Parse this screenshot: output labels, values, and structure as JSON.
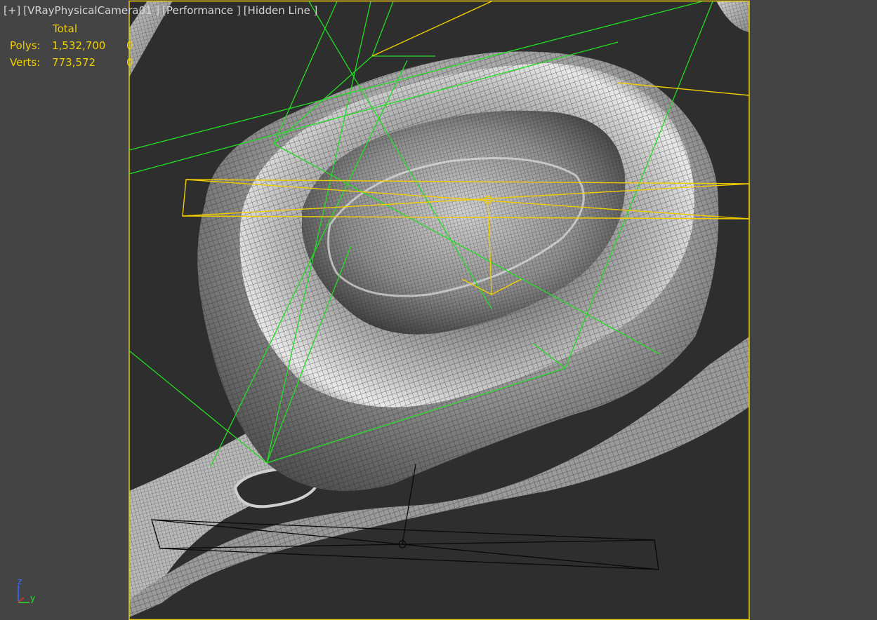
{
  "viewport": {
    "plus_menu": "[+]",
    "camera_menu": "[VRayPhysicalCamera01 ]",
    "mode_menu": "[Performance ]",
    "shading_menu": "[Hidden Line ]"
  },
  "stats": {
    "column_header": "Total",
    "polys_label": "Polys:",
    "polys_total": "1,532,700",
    "polys_selected": "0",
    "verts_label": "Verts:",
    "verts_total": "773,572",
    "verts_selected": "0"
  },
  "axis": {
    "z_label": "z",
    "y_label": "y"
  },
  "colors": {
    "viewport_bg": "#444444",
    "scene_bg": "#2e2e2e",
    "mesh_light": "#d8d8d8",
    "mesh_dark": "#5a5a5a",
    "stat_text": "#f0d000",
    "safe_frame": "#e6c800",
    "camera_green": "#22dd22",
    "target_yellow": "#f0cc00"
  }
}
